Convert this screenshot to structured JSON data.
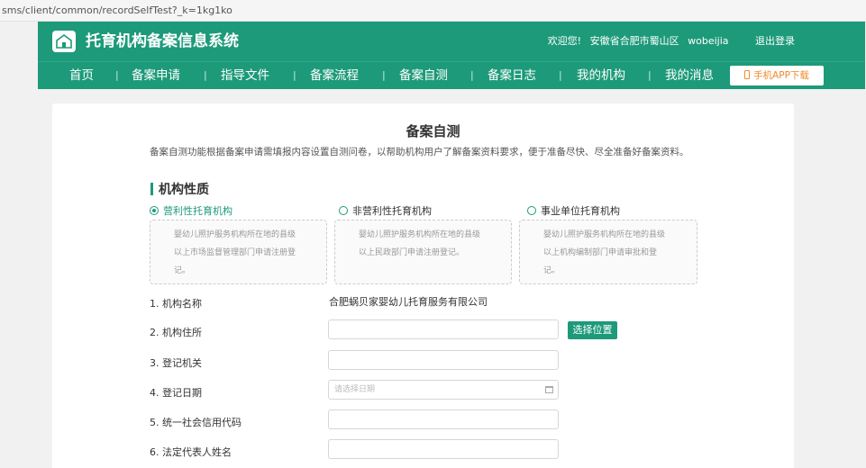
{
  "browser": {
    "url": "sms/client/common/recordSelfTest?_k=1kg1ko"
  },
  "header": {
    "logo_icon": "house-logo-icon",
    "title": "托育机构备案信息系统",
    "welcome": "欢迎您!",
    "region": "安徽省合肥市蜀山区",
    "username": "wobeijia",
    "logout": "退出登录"
  },
  "nav": {
    "items": [
      "首页",
      "备案申请",
      "指导文件",
      "备案流程",
      "备案自测",
      "备案日志",
      "我的机构",
      "我的消息"
    ],
    "separator": "|",
    "app_download": "手机APP下载",
    "app_icon": "phone-icon"
  },
  "page": {
    "title": "备案自测",
    "description": "备案自测功能根据备案申请需填报内容设置自测问卷，以帮助机构用户了解备案资料要求，便于准备尽快、尽全准备好备案资料。"
  },
  "section": {
    "title": "机构性质",
    "options": [
      {
        "label": "营利性托育机构",
        "checked": true,
        "desc_lines": [
          "婴幼儿照护服务机构所在地的县级",
          "以上市场监督管理部门申请注册登",
          "记。"
        ]
      },
      {
        "label": "非营利性托育机构",
        "checked": false,
        "desc_lines": [
          "婴幼儿照护服务机构所在地的县级",
          "以上民政部门申请注册登记。"
        ]
      },
      {
        "label": "事业单位托育机构",
        "checked": false,
        "desc_lines": [
          "婴幼儿照护服务机构所在地的县级",
          "以上机构编制部门申请审批和登",
          "记。"
        ]
      }
    ]
  },
  "form": {
    "fields": [
      {
        "label": "1. 机构名称",
        "value": "合肥蜗贝家婴幼儿托育服务有限公司"
      },
      {
        "label": "2. 机构住所",
        "value": ""
      },
      {
        "label": "3. 登记机关",
        "value": ""
      },
      {
        "label": "4. 登记日期",
        "value": "",
        "placeholder": "请选择日期"
      },
      {
        "label": "5. 统一社会信用代码",
        "value": ""
      },
      {
        "label": "6. 法定代表人姓名",
        "value": ""
      }
    ],
    "select_location": "选择位置",
    "calendar_icon": "calendar-icon"
  },
  "colors": {
    "brand": "#1d9a7a",
    "accent_orange": "#f08a2c"
  }
}
